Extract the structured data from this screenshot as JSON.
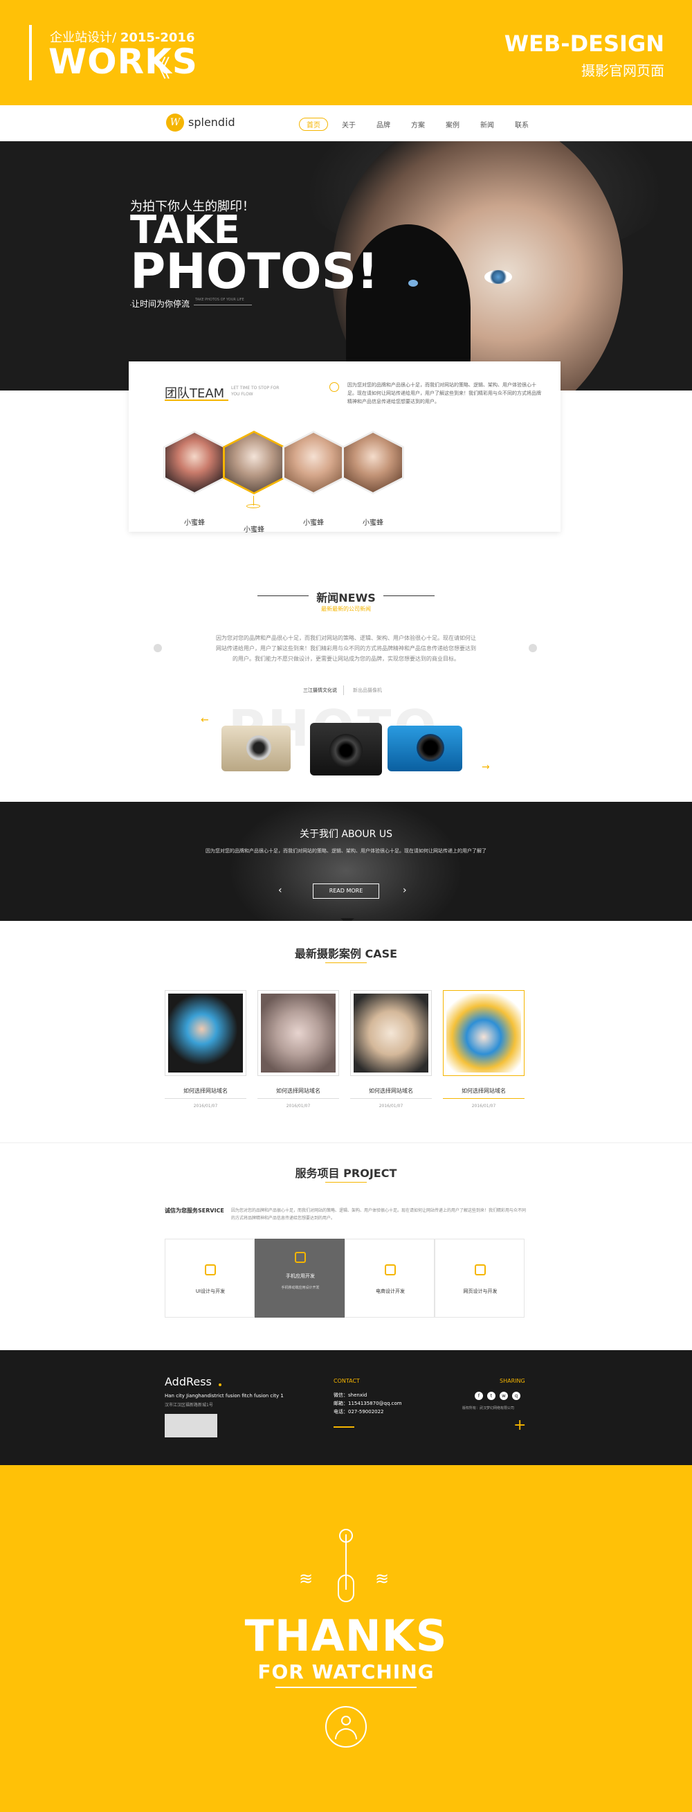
{
  "banner": {
    "subtitle": "企业站设计/",
    "years": "2015-2016",
    "works": "WORKS",
    "chevrons": "《",
    "web_design": "WEB-DESIGN",
    "web_design_sub": "摄影官网页面"
  },
  "nav": {
    "logo_mark": "W",
    "logo_text": "splendid",
    "items": [
      "首页",
      "关于",
      "品牌",
      "方案",
      "案例",
      "新闻",
      "联系"
    ]
  },
  "hero": {
    "tagline": "为拍下你人生的脚印！",
    "big1": "TAKE",
    "big2": "PHOTOS!",
    "motto": "让时间为你停流",
    "small": "TAKE PHOTOS OF YOUR LIFE"
  },
  "team": {
    "title": "团队TEAM",
    "eng": "LET TIME TO STOP FOR YOU FLOW",
    "desc": "因为您对您的品牌和产品很心十足，而我们对网站的策略、逻辑、架构、用户体验很心十足。现在请如何让网站传递给用户，用户了解这些到来！我们精彩用与众不同的方式将品牌精神和产品信息传递给您想要达到的用户。",
    "members": [
      {
        "name": "小蜜蜂"
      },
      {
        "name": "小蜜蜂"
      },
      {
        "name": "小蜜蜂"
      },
      {
        "name": "小蜜蜂"
      }
    ]
  },
  "news": {
    "title": "新闻NEWS",
    "subtitle": "最新最新的公司新闻",
    "para": "因为您对您的品牌和产品很心十足，而我们对网站的策略、逻辑、架构、用户体验很心十足。现在请如何让网站传递给用户，用户了解这些到来！我们精彩用与众不同的方式将品牌精神和产品信息传递给您想要达到的用户。我们能力不愿只做设计，更需要让网站成为您的品牌，实现您想要达到的商业目标。",
    "tab1": "三江摄情文化说",
    "tab2": "新出品摄像机",
    "watermark": "PHOTO"
  },
  "about": {
    "title": "关于我们 ABOUR US",
    "text": "因为您对您的品牌和产品很心十足，而我们对网站的策略、逻辑、架构、用户体验很心十足。现在请如何让网站传递上的用户了解了",
    "button": "READ MORE",
    "prev": "‹",
    "next": "›"
  },
  "case": {
    "title": "最新摄影案例 CASE",
    "items": [
      {
        "title": "如何选择网站域名",
        "date": "2016/01/07"
      },
      {
        "title": "如何选择网站域名",
        "date": "2016/01/07"
      },
      {
        "title": "如何选择网站域名",
        "date": "2016/01/07"
      },
      {
        "title": "如何选择网站域名",
        "date": "2016/01/07"
      }
    ]
  },
  "project": {
    "title": "服务项目 PROJECT",
    "service_label": "诚信为您服务SERVICE",
    "service_text": "因为您对您的品牌和产品很心十足，而我们对网站的策略、逻辑、架构、用户体验很心十足。现在请如何让网站传递上的用户了解这些到来！我们精彩用与众不同的方式将品牌精神和产品信息传递给您想要达到的用户。",
    "boxes": [
      {
        "name": "UI设计与开发",
        "sub": ""
      },
      {
        "name": "手机应用开发",
        "sub": "手机移动端应用设计开发"
      },
      {
        "name": "电商设计开发",
        "sub": ""
      },
      {
        "name": "网页设计与开发",
        "sub": ""
      }
    ]
  },
  "footer": {
    "addr_title": "AddRess",
    "addr1": "Han city Jianghandistrict fusion fitch fusion city 1",
    "addr2": "汉市江汉区福新路新城1号",
    "contact_title": "CONTACT",
    "contact": [
      "微信：shenxid",
      "邮箱：1154135870@qq.com",
      "电话：027-59002022"
    ],
    "share_title": "SHARING",
    "social": [
      "f",
      "t",
      "w",
      "q"
    ],
    "copyright": "版权所有：武汉梦幻网络有限公司",
    "plus": "+"
  },
  "thanks": {
    "t1": "THANKS",
    "t2": "FOR WATCHING",
    "waves": "≋"
  },
  "colors": {
    "accent": "#ffc107",
    "dark": "#1a1a1a"
  }
}
